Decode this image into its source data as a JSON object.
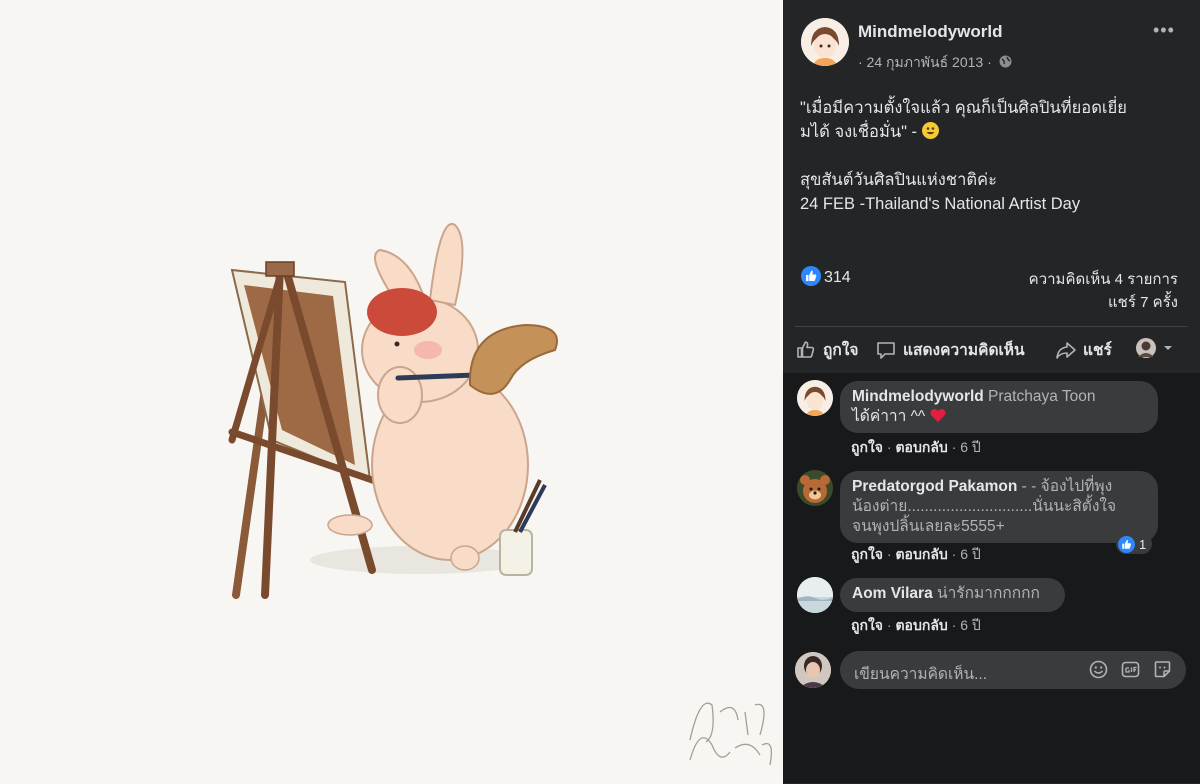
{
  "post": {
    "author": "Mindmelodyworld",
    "date": "· 24 กุมภาพันธ์ 2013 ·",
    "privacy_icon": "globe-icon",
    "text_lines": [
      "\"เมื่อมีความตั้งใจแล้ว คุณก็เป็นศิลปินที่ยอดเยี่ย",
      "มได้ จงเชื่อมั่น\" -",
      "",
      "สุขสันต์วันศิลปินแห่งชาติค่ะ",
      "24 FEB -Thailand's National Artist Day"
    ],
    "emoji": "smiley-emoji"
  },
  "reactions": {
    "count": "314",
    "comments_count": "ความคิดเห็น 4 รายการ",
    "shares_count": "แชร์ 7 ครั้ง"
  },
  "actions": {
    "like": "ถูกใจ",
    "comment": "แสดงความคิดเห็น",
    "share": "แชร์"
  },
  "comments": [
    {
      "author": "Mindmelodyworld",
      "text": " Pratchaya Toon",
      "text2": "ได้ค่าาา ^^",
      "like": "ถูกใจ",
      "reply": "ตอบกลับ",
      "time": "· 6 ปี"
    },
    {
      "author": "Predatorgod Pakamon",
      "text": " - - จ้องไปที่พุง",
      "text2": "น้องต่าย.............................นั่นนะสิตั้งใจ",
      "text3": "จนพุงปลิ้นเลยละ5555+",
      "like": "ถูกใจ",
      "reply": "ตอบกลับ",
      "time": "· 6 ปี",
      "reaction_count": "1"
    },
    {
      "author": "Aom Vilara",
      "text": " น่ารักมากกกกก",
      "like": "ถูกใจ",
      "reply": "ตอบกลับ",
      "time": "· 6 ปี"
    }
  ],
  "composer": {
    "placeholder": "เขียนความคิดเห็น..."
  },
  "signature": "Mind Melody",
  "colors": {
    "accent": "#2d88ff",
    "panel": "#242526",
    "comments_bg": "#18191a",
    "bubble": "#3a3b3c"
  }
}
